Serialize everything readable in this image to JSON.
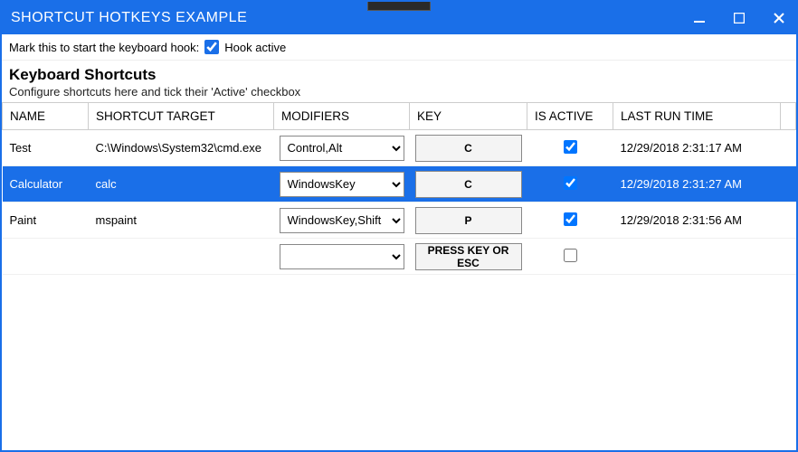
{
  "window": {
    "title": "SHORTCUT HOTKEYS EXAMPLE"
  },
  "hook": {
    "label": "Mark this to start the keyboard hook:",
    "checked": true,
    "status": "Hook active"
  },
  "section": {
    "heading": "Keyboard Shortcuts",
    "subtext": "Configure shortcuts here and tick their 'Active' checkbox"
  },
  "columns": {
    "name": "NAME",
    "target": "SHORTCUT TARGET",
    "modifiers": "MODIFIERS",
    "key": "KEY",
    "active": "IS ACTIVE",
    "time": "LAST RUN TIME"
  },
  "rows": [
    {
      "name": "Test",
      "target": "C:\\Windows\\System32\\cmd.exe",
      "modifiers": "Control,Alt",
      "key": "C",
      "active": true,
      "time": "12/29/2018 2:31:17 AM",
      "selected": false
    },
    {
      "name": "Calculator",
      "target": "calc",
      "modifiers": "WindowsKey",
      "key": "C",
      "active": true,
      "time": "12/29/2018 2:31:27 AM",
      "selected": true
    },
    {
      "name": "Paint",
      "target": "mspaint",
      "modifiers": "WindowsKey,Shift",
      "key": "P",
      "active": true,
      "time": "12/29/2018 2:31:56 AM",
      "selected": false
    }
  ],
  "newrow": {
    "modifiers": "",
    "key_placeholder": "PRESS KEY OR ESC",
    "active": false
  }
}
